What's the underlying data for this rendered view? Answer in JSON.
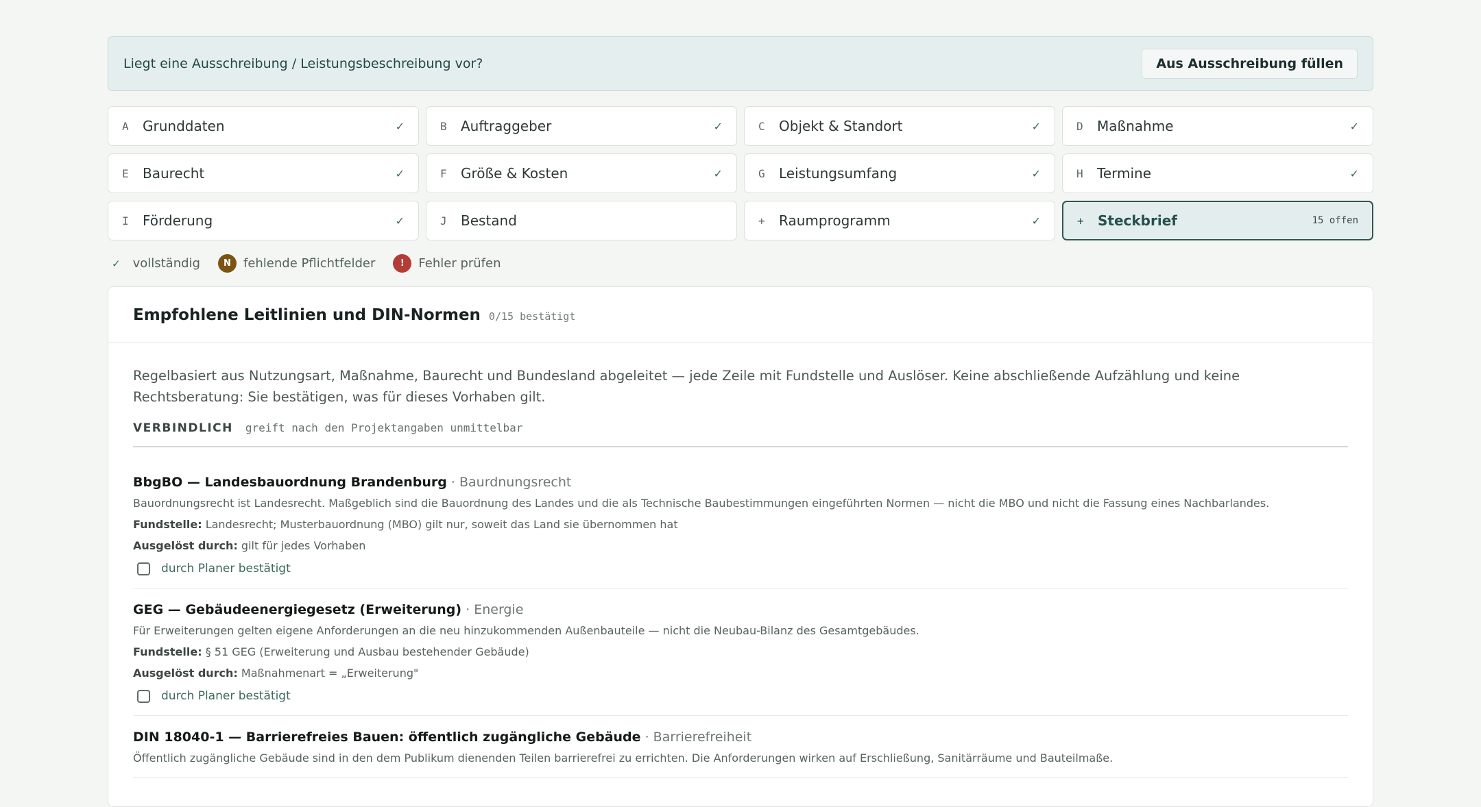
{
  "banner": {
    "question": "Liegt eine Ausschreibung / Leistungsbeschreibung vor?",
    "button": "Aus Ausschreibung füllen"
  },
  "tabs": [
    {
      "key": "A",
      "label": "Grunddaten",
      "mark": "✓"
    },
    {
      "key": "B",
      "label": "Auftraggeber",
      "mark": "✓"
    },
    {
      "key": "C",
      "label": "Objekt & Standort",
      "mark": "✓"
    },
    {
      "key": "D",
      "label": "Maßnahme",
      "mark": "✓"
    },
    {
      "key": "E",
      "label": "Baurecht",
      "mark": "✓"
    },
    {
      "key": "F",
      "label": "Größe & Kosten",
      "mark": "✓"
    },
    {
      "key": "G",
      "label": "Leistungsumfang",
      "mark": "✓"
    },
    {
      "key": "H",
      "label": "Termine",
      "mark": "✓"
    },
    {
      "key": "I",
      "label": "Förderung",
      "mark": "✓"
    },
    {
      "key": "J",
      "label": "Bestand",
      "mark": ""
    },
    {
      "key": "+",
      "label": "Raumprogramm",
      "mark": "✓"
    },
    {
      "key": "+",
      "label": "Steckbrief",
      "mark": "15 offen"
    }
  ],
  "legend": {
    "complete_mark": "✓",
    "complete": "vollständig",
    "missing_mark": "N",
    "missing": "fehlende Pflichtfelder",
    "error_mark": "!",
    "error": "Fehler prüfen"
  },
  "card": {
    "title": "Empfohlene Leitlinien und DIN-Normen",
    "count": "0/15 bestätigt",
    "intro": "Regelbasiert aus Nutzungsart, Maßnahme, Baurecht und Bundesland abgeleitet — jede Zeile mit Fundstelle und Auslöser. Keine abschließende Aufzählung und keine Rechtsberatung: Sie bestätigen, was für dieses Vorhaben gilt.",
    "section_label": "VERBINDLICH",
    "section_sub": "greift nach den Projektangaben unmittelbar",
    "source_label": "Fundstelle:",
    "trigger_label": "Ausgelöst durch:",
    "confirm_label": "durch Planer bestätigt",
    "rules": [
      {
        "title": "BbgBO — Landesbauordnung Brandenburg",
        "category": "· Baurdnungsrecht",
        "description": "Bauordnungsrecht ist Landesrecht. Maßgeblich sind die Bauordnung des Landes und die als Technische Baubestimmungen eingeführten Normen — nicht die MBO und nicht die Fassung eines Nachbarlandes.",
        "source": "Landesrecht; Musterbauordnung (MBO) gilt nur, soweit das Land sie übernommen hat",
        "trigger": "gilt für jedes Vorhaben"
      },
      {
        "title": "GEG — Gebäudeenergiegesetz (Erweiterung)",
        "category": "· Energie",
        "description": "Für Erweiterungen gelten eigene Anforderungen an die neu hinzukommenden Außenbauteile — nicht die Neubau-Bilanz des Gesamtgebäudes.",
        "source": "§ 51 GEG (Erweiterung und Ausbau bestehender Gebäude)",
        "trigger": "Maßnahmenart = „Erweiterung\""
      },
      {
        "title": "DIN 18040-1 — Barrierefreies Bauen: öffentlich zugängliche Gebäude",
        "category": "· Barrierefreiheit",
        "description": "Öffentlich zugängliche Gebäude sind in den dem Publikum dienenden Teilen barrierefrei zu errichten. Die Anforderungen wirken auf Erschließung, Sanitärräume und Bauteilmaße.",
        "source": "",
        "trigger": ""
      }
    ]
  }
}
